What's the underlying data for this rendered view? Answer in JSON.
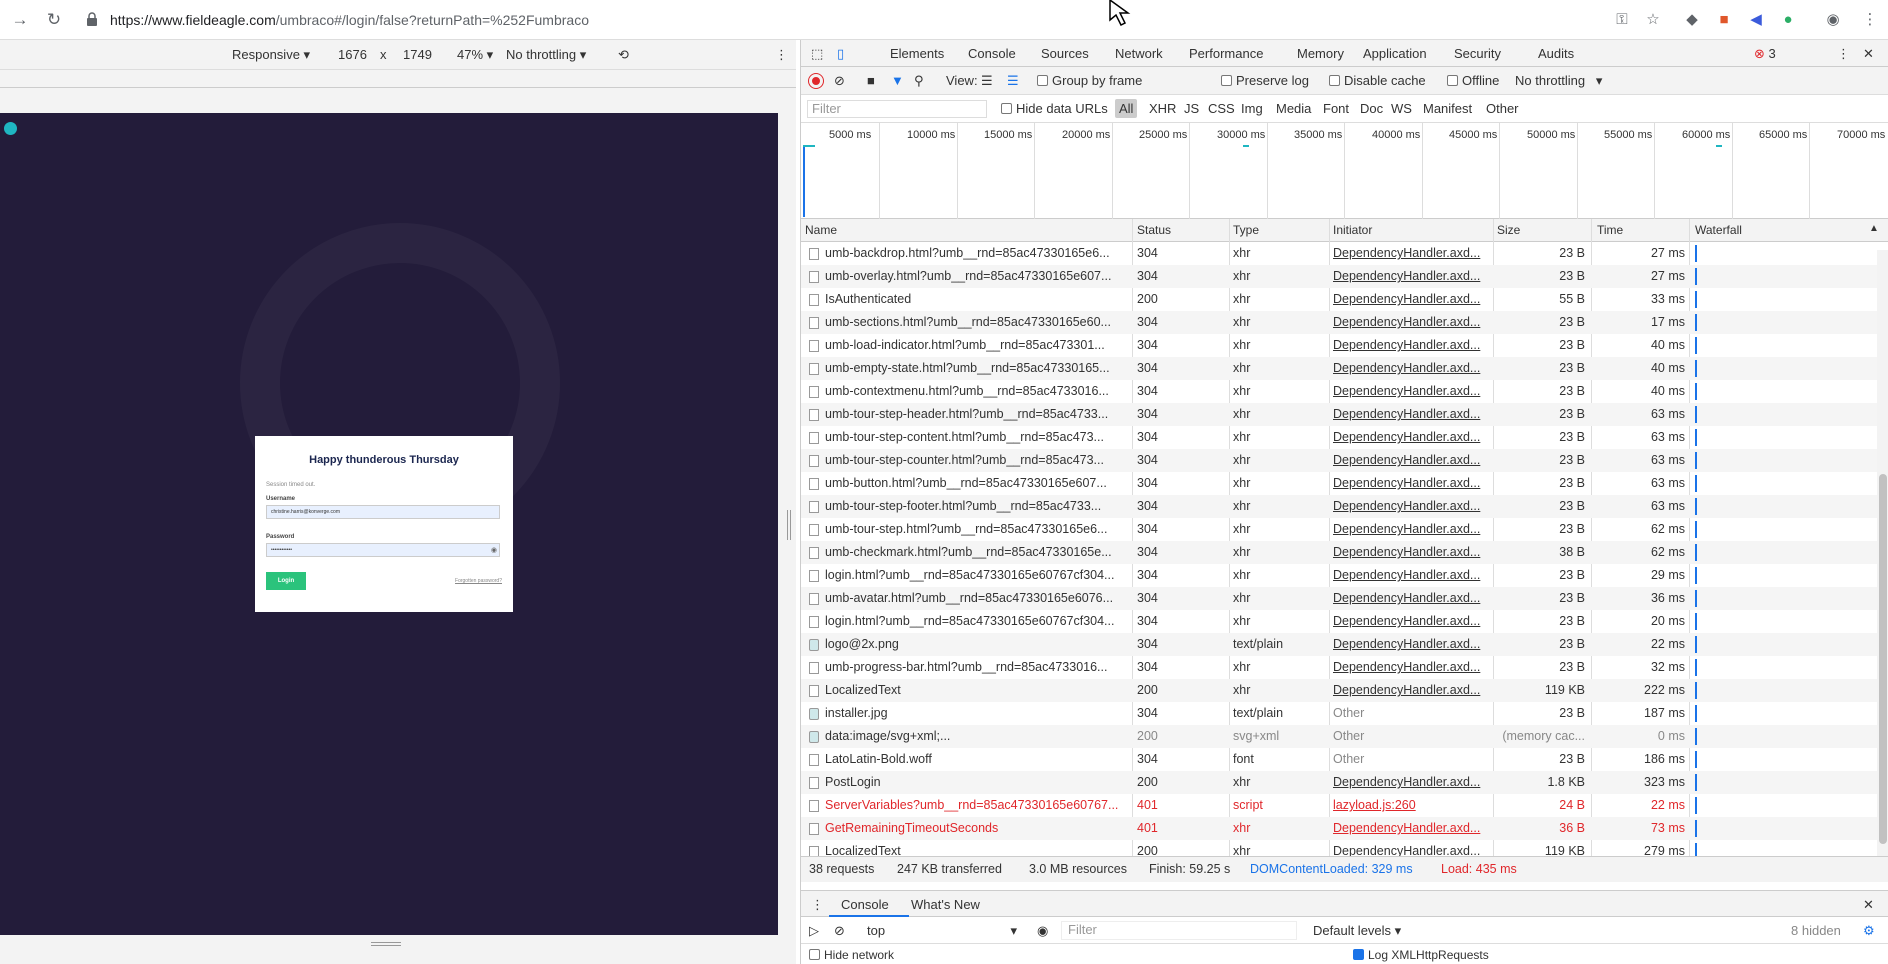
{
  "browser": {
    "url_host": "https://www.fieldeagle.com",
    "url_path": "/umbraco#/login/false?returnPath=%252Fumbraco"
  },
  "device_toolbar": {
    "mode": "Responsive",
    "width": "1676",
    "times": "x",
    "height": "1749",
    "zoom": "47%",
    "throttling": "No throttling"
  },
  "login": {
    "heading": "Happy thunderous Thursday",
    "session_message": "Session timed out.",
    "username_label": "Username",
    "username_value": "christine.harris@konverge.com",
    "password_label": "Password",
    "password_value": "••••••••••••",
    "login_button": "Login",
    "forgotten": "Forgotten password?"
  },
  "devtools": {
    "tabs": [
      "Elements",
      "Console",
      "Sources",
      "Network",
      "Performance",
      "Memory",
      "Application",
      "Security",
      "Audits"
    ],
    "active_tab": "Network",
    "error_count": "3",
    "netbar": {
      "view_label": "View:",
      "group_by_frame": "Group by frame",
      "preserve_log": "Preserve log",
      "disable_cache": "Disable cache",
      "offline": "Offline",
      "throttling": "No throttling"
    },
    "filter": {
      "placeholder": "Filter",
      "hide_data_urls": "Hide data URLs",
      "types": [
        "All",
        "XHR",
        "JS",
        "CSS",
        "Img",
        "Media",
        "Font",
        "Doc",
        "WS",
        "Manifest",
        "Other"
      ]
    },
    "timeline_ticks": [
      "5000 ms",
      "10000 ms",
      "15000 ms",
      "20000 ms",
      "25000 ms",
      "30000 ms",
      "35000 ms",
      "40000 ms",
      "45000 ms",
      "50000 ms",
      "55000 ms",
      "60000 ms",
      "65000 ms",
      "70000 ms"
    ],
    "columns": [
      "Name",
      "Status",
      "Type",
      "Initiator",
      "Size",
      "Time",
      "Waterfall"
    ],
    "rows": [
      {
        "name": "umb-backdrop.html?umb__rnd=85ac47330165e6...",
        "status": "304",
        "type": "xhr",
        "initiator": "DependencyHandler.axd...",
        "size": "23 B",
        "time": "27 ms",
        "kind": "doc"
      },
      {
        "name": "umb-overlay.html?umb__rnd=85ac47330165e607...",
        "status": "304",
        "type": "xhr",
        "initiator": "DependencyHandler.axd...",
        "size": "23 B",
        "time": "27 ms",
        "kind": "doc"
      },
      {
        "name": "IsAuthenticated",
        "status": "200",
        "type": "xhr",
        "initiator": "DependencyHandler.axd...",
        "size": "55 B",
        "time": "33 ms",
        "kind": "doc"
      },
      {
        "name": "umb-sections.html?umb__rnd=85ac47330165e60...",
        "status": "304",
        "type": "xhr",
        "initiator": "DependencyHandler.axd...",
        "size": "23 B",
        "time": "17 ms",
        "kind": "doc"
      },
      {
        "name": "umb-load-indicator.html?umb__rnd=85ac473301...",
        "status": "304",
        "type": "xhr",
        "initiator": "DependencyHandler.axd...",
        "size": "23 B",
        "time": "40 ms",
        "kind": "doc"
      },
      {
        "name": "umb-empty-state.html?umb__rnd=85ac47330165...",
        "status": "304",
        "type": "xhr",
        "initiator": "DependencyHandler.axd...",
        "size": "23 B",
        "time": "40 ms",
        "kind": "doc"
      },
      {
        "name": "umb-contextmenu.html?umb__rnd=85ac4733016...",
        "status": "304",
        "type": "xhr",
        "initiator": "DependencyHandler.axd...",
        "size": "23 B",
        "time": "40 ms",
        "kind": "doc"
      },
      {
        "name": "umb-tour-step-header.html?umb__rnd=85ac4733...",
        "status": "304",
        "type": "xhr",
        "initiator": "DependencyHandler.axd...",
        "size": "23 B",
        "time": "63 ms",
        "kind": "doc"
      },
      {
        "name": "umb-tour-step-content.html?umb__rnd=85ac473...",
        "status": "304",
        "type": "xhr",
        "initiator": "DependencyHandler.axd...",
        "size": "23 B",
        "time": "63 ms",
        "kind": "doc"
      },
      {
        "name": "umb-tour-step-counter.html?umb__rnd=85ac473...",
        "status": "304",
        "type": "xhr",
        "initiator": "DependencyHandler.axd...",
        "size": "23 B",
        "time": "63 ms",
        "kind": "doc"
      },
      {
        "name": "umb-button.html?umb__rnd=85ac47330165e607...",
        "status": "304",
        "type": "xhr",
        "initiator": "DependencyHandler.axd...",
        "size": "23 B",
        "time": "63 ms",
        "kind": "doc"
      },
      {
        "name": "umb-tour-step-footer.html?umb__rnd=85ac4733...",
        "status": "304",
        "type": "xhr",
        "initiator": "DependencyHandler.axd...",
        "size": "23 B",
        "time": "63 ms",
        "kind": "doc"
      },
      {
        "name": "umb-tour-step.html?umb__rnd=85ac47330165e6...",
        "status": "304",
        "type": "xhr",
        "initiator": "DependencyHandler.axd...",
        "size": "23 B",
        "time": "62 ms",
        "kind": "doc"
      },
      {
        "name": "umb-checkmark.html?umb__rnd=85ac47330165e...",
        "status": "304",
        "type": "xhr",
        "initiator": "DependencyHandler.axd...",
        "size": "38 B",
        "time": "62 ms",
        "kind": "doc"
      },
      {
        "name": "login.html?umb__rnd=85ac47330165e60767cf304...",
        "status": "304",
        "type": "xhr",
        "initiator": "DependencyHandler.axd...",
        "size": "23 B",
        "time": "29 ms",
        "kind": "doc"
      },
      {
        "name": "umb-avatar.html?umb__rnd=85ac47330165e6076...",
        "status": "304",
        "type": "xhr",
        "initiator": "DependencyHandler.axd...",
        "size": "23 B",
        "time": "36 ms",
        "kind": "doc"
      },
      {
        "name": "login.html?umb__rnd=85ac47330165e60767cf304...",
        "status": "304",
        "type": "xhr",
        "initiator": "DependencyHandler.axd...",
        "size": "23 B",
        "time": "20 ms",
        "kind": "doc"
      },
      {
        "name": "logo@2x.png",
        "status": "304",
        "type": "text/plain",
        "initiator": "DependencyHandler.axd...",
        "size": "23 B",
        "time": "22 ms",
        "kind": "img"
      },
      {
        "name": "umb-progress-bar.html?umb__rnd=85ac4733016...",
        "status": "304",
        "type": "xhr",
        "initiator": "DependencyHandler.axd...",
        "size": "23 B",
        "time": "32 ms",
        "kind": "doc"
      },
      {
        "name": "LocalizedText",
        "status": "200",
        "type": "xhr",
        "initiator": "DependencyHandler.axd...",
        "size": "119 KB",
        "time": "222 ms",
        "kind": "doc"
      },
      {
        "name": "installer.jpg",
        "status": "304",
        "type": "text/plain",
        "initiator": "Other",
        "size": "23 B",
        "time": "187 ms",
        "kind": "img"
      },
      {
        "name": "data:image/svg+xml;...",
        "status": "200",
        "type": "svg+xml",
        "initiator": "Other",
        "size": "(memory cac...",
        "time": "0 ms",
        "kind": "img",
        "muted": true
      },
      {
        "name": "LatoLatin-Bold.woff",
        "status": "304",
        "type": "font",
        "initiator": "Other",
        "size": "23 B",
        "time": "186 ms",
        "kind": "doc"
      },
      {
        "name": "PostLogin",
        "status": "200",
        "type": "xhr",
        "initiator": "DependencyHandler.axd...",
        "size": "1.8 KB",
        "time": "323 ms",
        "kind": "doc"
      },
      {
        "name": "ServerVariables?umb__rnd=85ac47330165e60767...",
        "status": "401",
        "type": "script",
        "initiator": "lazyload.js:260",
        "size": "24 B",
        "time": "22 ms",
        "kind": "doc",
        "error": true
      },
      {
        "name": "GetRemainingTimeoutSeconds",
        "status": "401",
        "type": "xhr",
        "initiator": "DependencyHandler.axd...",
        "size": "36 B",
        "time": "73 ms",
        "kind": "doc",
        "error": true
      },
      {
        "name": "LocalizedText",
        "status": "200",
        "type": "xhr",
        "initiator": "DependencyHandler.axd...",
        "size": "119 KB",
        "time": "279 ms",
        "kind": "doc"
      }
    ],
    "summary": {
      "requests": "38 requests",
      "transferred": "247 KB transferred",
      "resources": "3.0 MB resources",
      "finish": "Finish: 59.25 s",
      "domcontentloaded": "DOMContentLoaded: 329 ms",
      "load": "Load: 435 ms"
    },
    "drawer": {
      "tabs": [
        "Console",
        "What's New"
      ],
      "context": "top",
      "filter_placeholder": "Filter",
      "levels": "Default levels",
      "hidden": "8 hidden",
      "hide_network": "Hide network",
      "log_xhr": "Log XMLHttpRequests"
    }
  },
  "colors": {
    "accent": "#1a73e8",
    "error": "#e0272b",
    "login_green": "#2bc37c",
    "stage_bg": "#231c3a"
  }
}
